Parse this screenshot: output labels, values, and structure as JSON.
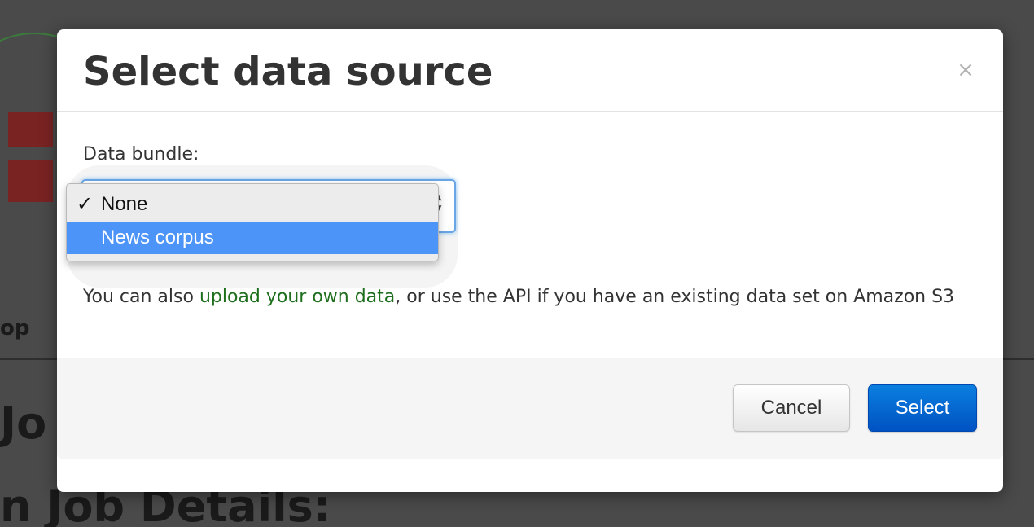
{
  "background": {
    "text_op": "op",
    "text_jo": "Jo",
    "text_job_details": "n Job Details:"
  },
  "modal": {
    "title": "Select data source",
    "close_glyph": "×",
    "body": {
      "field_label": "Data bundle:",
      "select": {
        "arrows_glyph_up": "▲",
        "arrows_glyph_down": "▼",
        "options": [
          {
            "label": "None",
            "selected": true,
            "check_glyph": "✓"
          },
          {
            "label": "News corpus",
            "highlighted": true
          }
        ]
      },
      "help": {
        "prefix": "You can also ",
        "link_text": "upload your own data",
        "suffix": ", or use the API if you have an existing data set on Amazon S3"
      }
    },
    "footer": {
      "cancel_label": "Cancel",
      "select_label": "Select"
    }
  },
  "colors": {
    "primary_button": "#0066d6",
    "link": "#1d6e1d",
    "highlight": "#4d94f8"
  }
}
